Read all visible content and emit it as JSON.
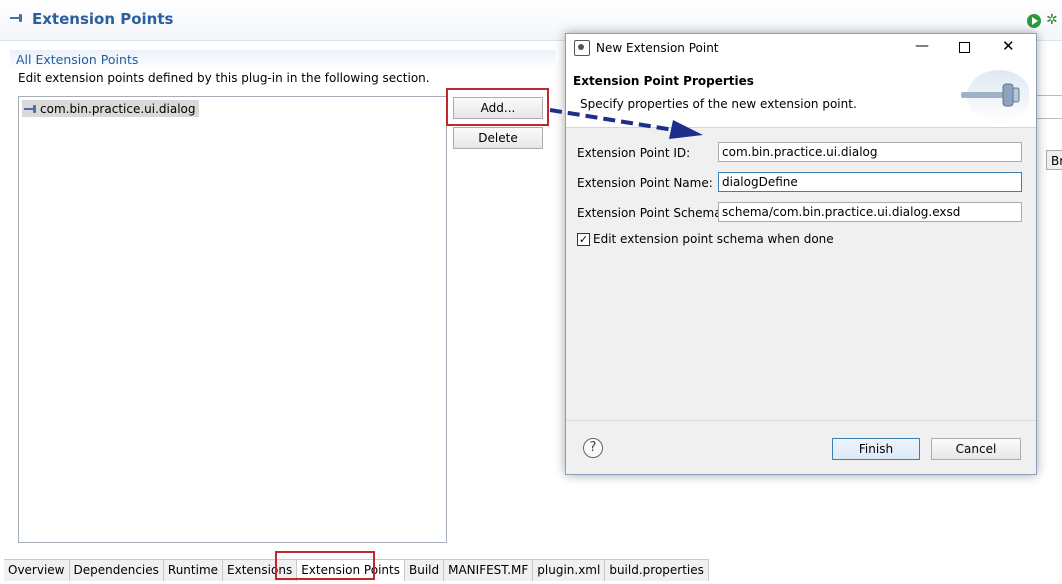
{
  "editor": {
    "title": "Extension Points",
    "section_title": "All Extension Points",
    "section_desc": "Edit extension points defined by this plug-in in the following section.",
    "tree_items": [
      "com.bin.practice.ui.dialog"
    ],
    "add_label": "Add...",
    "delete_label": "Delete",
    "partial_button": "Br"
  },
  "tabs": [
    "Overview",
    "Dependencies",
    "Runtime",
    "Extensions",
    "Extension Points",
    "Build",
    "MANIFEST.MF",
    "plugin.xml",
    "build.properties"
  ],
  "active_tab": "Extension Points",
  "dialog": {
    "title": "New Extension Point",
    "banner_title": "Extension Point Properties",
    "banner_desc": "Specify properties of the new extension point.",
    "id_label": "Extension Point ID:",
    "id_value": "com.bin.practice.ui.dialog",
    "name_label": "Extension Point Name:",
    "name_value": "dialogDefine",
    "schema_label": "Extension Point Schema:",
    "schema_value": "schema/com.bin.practice.ui.dialog.exsd",
    "checkbox_label": "Edit extension point schema when done",
    "checkbox_checked": true,
    "finish_label": "Finish",
    "cancel_label": "Cancel"
  },
  "colors": {
    "accent": "#2a5e9c",
    "highlight": "#c1272d",
    "arrow": "#1c2f8a"
  }
}
